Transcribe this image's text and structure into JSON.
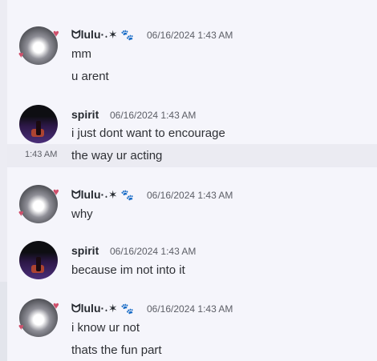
{
  "messages": [
    {
      "author": "ᗢlulu·˖✶",
      "badge": "🐾",
      "timestamp": "06/16/2024 1:43 AM",
      "lines": [
        "mm",
        "u arent"
      ]
    },
    {
      "author": "spirit",
      "timestamp": "06/16/2024 1:43 AM",
      "lines": [
        "i just dont want to encourage"
      ]
    },
    {
      "side_time": "1:43 AM",
      "lines": [
        "the way ur acting"
      ]
    },
    {
      "author": "ᗢlulu·˖✶",
      "badge": "🐾",
      "timestamp": "06/16/2024 1:43 AM",
      "lines": [
        "why"
      ]
    },
    {
      "author": "spirit",
      "timestamp": "06/16/2024 1:43 AM",
      "lines": [
        "because im not into it"
      ]
    },
    {
      "author": "ᗢlulu·˖✶",
      "badge": "🐾",
      "timestamp": "06/16/2024 1:43 AM",
      "lines": [
        "i know ur not",
        "thats the fun part"
      ]
    }
  ],
  "colors": {
    "background": "#f5f5fb",
    "hover_row": "#ebebf2",
    "badge": "#6b5cb5",
    "heart": "#d0506c"
  },
  "icons": {
    "avatar_deco": "heart-icon",
    "badge": "paw-icon"
  }
}
